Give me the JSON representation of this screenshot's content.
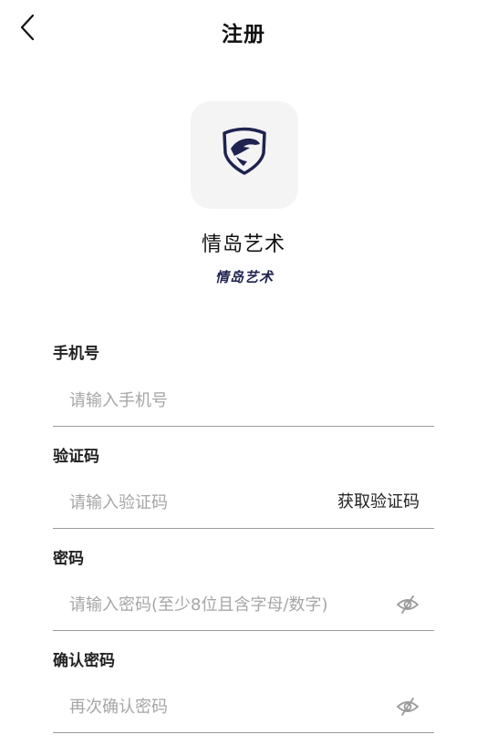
{
  "header": {
    "title": "注册"
  },
  "logo": {
    "text": "情岛艺术"
  },
  "app": {
    "name": "情岛艺术"
  },
  "form": {
    "phone": {
      "label": "手机号",
      "placeholder": "请输入手机号",
      "value": ""
    },
    "code": {
      "label": "验证码",
      "placeholder": "请输入验证码",
      "value": "",
      "action_label": "获取验证码"
    },
    "password": {
      "label": "密码",
      "placeholder": "请输入密码(至少8位且含字母/数字)",
      "value": "",
      "toggle_icon": "eye-closed-icon"
    },
    "confirm": {
      "label": "确认密码",
      "placeholder": "再次确认密码",
      "value": "",
      "toggle_icon": "eye-closed-icon"
    }
  },
  "colors": {
    "logo_navy": "#1f2350",
    "logo_bg": "#f4f4f4",
    "divider": "#9a9a9a",
    "placeholder": "#a6a6a6"
  }
}
